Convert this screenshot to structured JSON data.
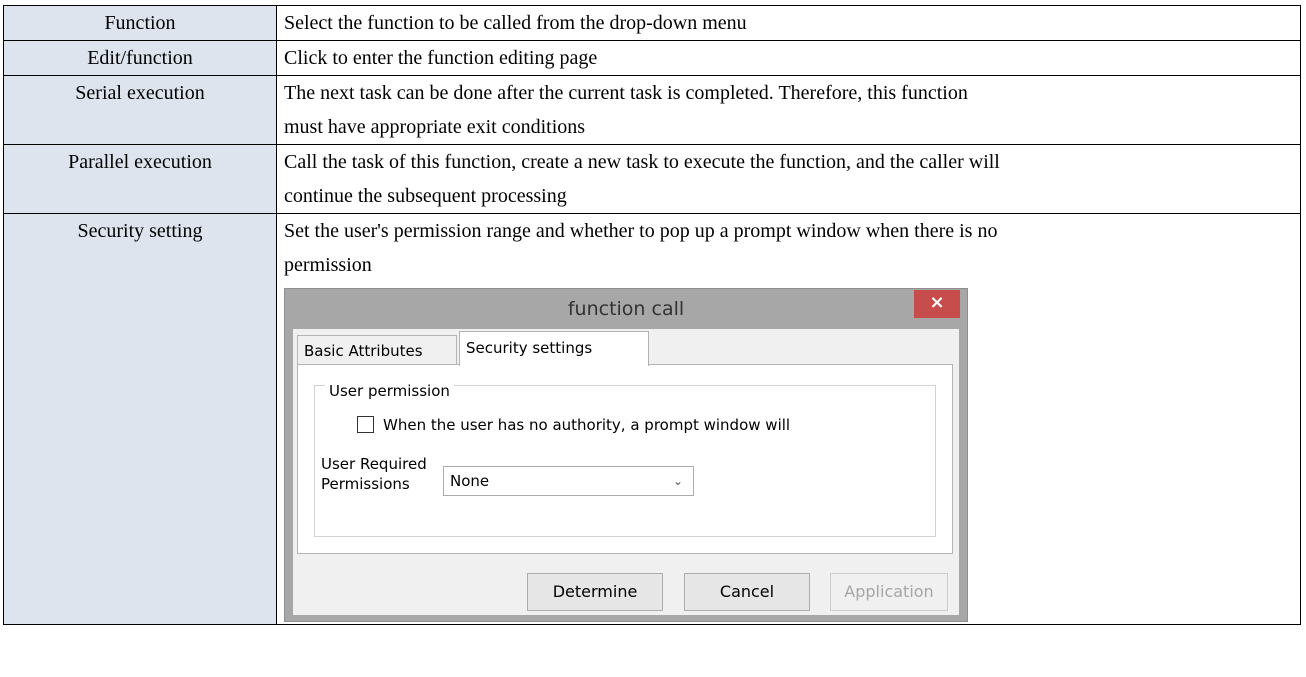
{
  "rows": [
    {
      "name": "Function",
      "desc": [
        "Select the function to be called from the drop-down menu"
      ]
    },
    {
      "name": "Edit/function",
      "desc": [
        "Click to enter the function editing page"
      ]
    },
    {
      "name": "Serial execution",
      "desc": [
        "The next task can be done after the current task is completed. Therefore, this function",
        "must have appropriate exit conditions"
      ]
    },
    {
      "name": "Parallel execution",
      "desc": [
        "Call the task of this function, create a new task to execute the function, and the caller will",
        "continue the subsequent processing"
      ]
    },
    {
      "name": "Security setting",
      "desc": [
        "Set the user's permission range and whether to pop up a prompt window when there is no",
        "permission"
      ]
    }
  ],
  "dialog": {
    "title": "function call",
    "close_glyph": "×",
    "tabs": [
      "Basic Attributes",
      "Security settings"
    ],
    "group_title": "User permission",
    "checkbox_label": "When the user has no authority, a prompt window will",
    "permissions_label": "User Required Permissions",
    "permissions_value": "None",
    "buttons": {
      "ok": "Determine",
      "cancel": "Cancel",
      "apply": "Application"
    }
  }
}
